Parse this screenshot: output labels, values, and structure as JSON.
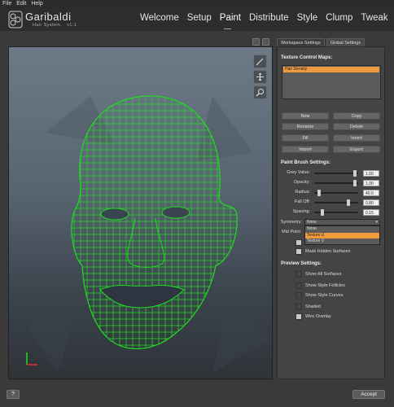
{
  "menu": {
    "file": "File",
    "edit": "Edit",
    "help": "Help"
  },
  "logo": {
    "title": "Garibaldi",
    "subtitle": "Hair System.",
    "version": "v1.1"
  },
  "nav": [
    "Welcome",
    "Setup",
    "Paint",
    "Distribute",
    "Style",
    "Clump",
    "Tweak"
  ],
  "tabs": {
    "workspace": "Workspace Settings",
    "global": "Global Settings"
  },
  "texture": {
    "title": "Texture Control Maps:",
    "selected_item": "Hair Density",
    "buttons": [
      "New",
      "Copy",
      "Rename",
      "Delete",
      "Fill",
      "Invert",
      "Import",
      "Export"
    ]
  },
  "brush": {
    "title": "Paint Brush Settings:",
    "grey_value": {
      "label": "Grey Value:",
      "value": "1.00",
      "level": 0.95
    },
    "opacity": {
      "label": "Opacity:",
      "value": "1.00",
      "level": 0.95
    },
    "radius": {
      "label": "Radius:",
      "value": "40.0",
      "level": 0.08
    },
    "fall_off": {
      "label": "Fall Off:",
      "value": "0.80",
      "level": 0.8
    },
    "spacing": {
      "label": "Spacing:",
      "value": "0.15",
      "level": 0.15
    },
    "symmetry": {
      "label": "Symmetry:",
      "value": "None",
      "options": [
        "None",
        "Texture U",
        "Texture V"
      ],
      "highlighted": "Texture U"
    },
    "mid_point": {
      "label": "Mid Point"
    },
    "mask_hidden": {
      "label": "Mask Hidden Surfaces"
    }
  },
  "preview": {
    "title": "Preview Settings:",
    "show_all_surfaces": "Show All Surfaces",
    "show_style_follicles": "Show Style Follicles",
    "show_style_curves": "Show Style Curves",
    "shaded": "Shaded",
    "wire_overlay": "Wire Overlay"
  },
  "footer": {
    "help": "?",
    "accept": "Accept"
  },
  "icons": {
    "viewport": [
      "brush-icon",
      "move-icon",
      "zoom-icon"
    ],
    "wireframe_color": "#1fdd1f",
    "highlight_color": "#f09a3e"
  }
}
